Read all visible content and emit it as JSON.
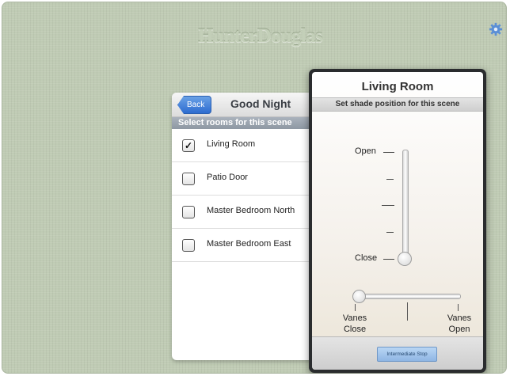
{
  "header": {
    "logo_text": "HunterDouglas",
    "settings_icon": "gear-icon"
  },
  "scene_panel": {
    "back_label": "Back",
    "title": "Good Night",
    "section_label": "Select rooms for this scene",
    "rooms": [
      {
        "label": "Living Room",
        "checked": true,
        "mark": "✓"
      },
      {
        "label": "Patio Door",
        "checked": false,
        "mark": ""
      },
      {
        "label": "Master Bedroom North",
        "checked": false,
        "mark": ""
      },
      {
        "label": "Master Bedroom East",
        "checked": false,
        "mark": ""
      }
    ]
  },
  "shade_panel": {
    "title": "Living Room",
    "subtitle": "Set shade position for this scene",
    "position_slider": {
      "top_label": "Open",
      "bottom_label": "Close",
      "value": 0
    },
    "vanes_slider": {
      "left_label_line1": "Vanes",
      "left_label_line2": "Close",
      "right_label_line1": "Vanes",
      "right_label_line2": "Open",
      "value": 0
    },
    "stop_button_label": "Intermediate Stop"
  },
  "colors": {
    "background": "#bfcbb4",
    "accent_blue": "#2d6cd0",
    "section_bar": "#8e98a3"
  }
}
